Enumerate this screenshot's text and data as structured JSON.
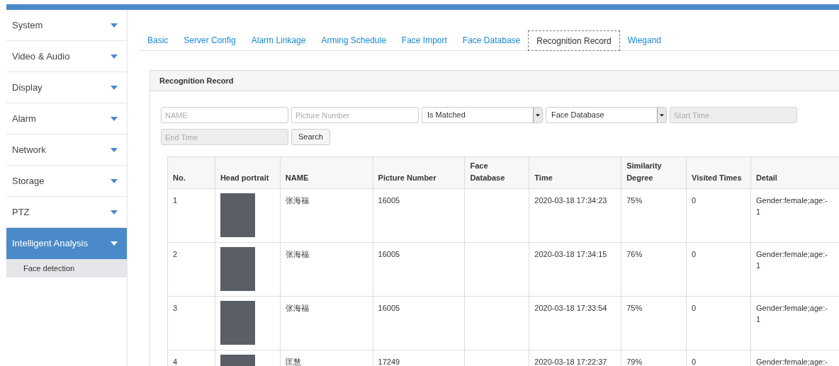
{
  "sidebar": {
    "items": [
      {
        "label": "System",
        "selected": false
      },
      {
        "label": "Video & Audio",
        "selected": false
      },
      {
        "label": "Display",
        "selected": false
      },
      {
        "label": "Alarm",
        "selected": false
      },
      {
        "label": "Network",
        "selected": false
      },
      {
        "label": "Storage",
        "selected": false
      },
      {
        "label": "PTZ",
        "selected": false
      },
      {
        "label": "Intelligent Analysis",
        "selected": true,
        "children": [
          {
            "label": "Face detection"
          }
        ]
      }
    ]
  },
  "tabs": [
    {
      "label": "Basic",
      "selected": false
    },
    {
      "label": "Server Config",
      "selected": false
    },
    {
      "label": "Alarm Linkage",
      "selected": false
    },
    {
      "label": "Arming Schedule",
      "selected": false
    },
    {
      "label": "Face Import",
      "selected": false
    },
    {
      "label": "Face Database",
      "selected": false
    },
    {
      "label": "Recognition Record",
      "selected": true
    },
    {
      "label": "Wiegand",
      "selected": false
    }
  ],
  "panel": {
    "title": "Recognition Record",
    "filters": [
      {
        "kind": "text",
        "placeholder": "NAME",
        "disabled": false
      },
      {
        "kind": "text",
        "placeholder": "Picture Number",
        "disabled": false
      },
      {
        "kind": "select",
        "value": "Is Matched"
      },
      {
        "kind": "select",
        "value": "Face Database"
      },
      {
        "kind": "text",
        "placeholder": "Start Time",
        "disabled": true
      },
      {
        "kind": "text",
        "placeholder": "End Time",
        "disabled": true
      },
      {
        "kind": "button",
        "label": "Search"
      }
    ],
    "table": {
      "columns": [
        "No.",
        "Head portrait",
        "NAME",
        "Picture Number",
        "Face Database",
        "Time",
        "Similarity Degree",
        "Visited Times",
        "Detail"
      ],
      "rows": [
        {
          "no": "1",
          "name": "张海福",
          "picture_number": "16005",
          "time": "2020-03-18 17:34:23",
          "similarity": "75%",
          "visited": "0",
          "detail": "Gender:female;age:-1"
        },
        {
          "no": "2",
          "name": "张海福",
          "picture_number": "16005",
          "time": "2020-03-18 17:34:15",
          "similarity": "76%",
          "visited": "0",
          "detail": "Gender:female;age:-1"
        },
        {
          "no": "3",
          "name": "张海福",
          "picture_number": "16005",
          "time": "2020-03-18 17:33:54",
          "similarity": "75%",
          "visited": "0",
          "detail": "Gender:female;age:-1"
        },
        {
          "no": "4",
          "name": "匡慧",
          "picture_number": "17249",
          "time": "2020-03-18 17:22:37",
          "similarity": "79%",
          "visited": "0",
          "detail": "Gender:female;age:-"
        }
      ]
    }
  }
}
